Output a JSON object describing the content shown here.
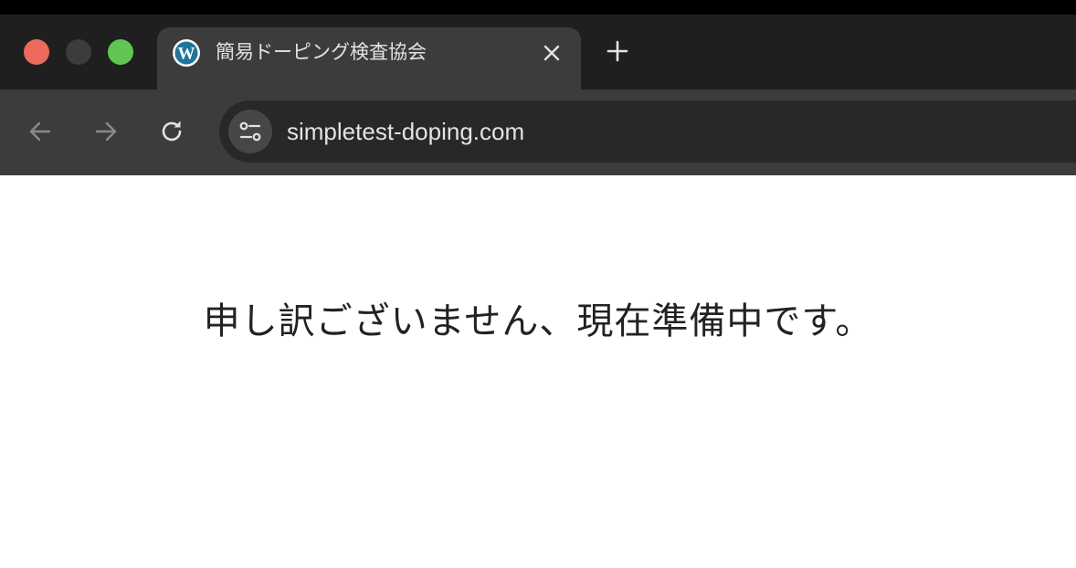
{
  "tab": {
    "title": "簡易ドーピング検査協会",
    "favicon": "wordpress-icon"
  },
  "address_bar": {
    "url": "simpletest-doping.com"
  },
  "page": {
    "message": "申し訳ございません、現在準備中です。"
  },
  "colors": {
    "tabbar_bg": "#1f1f1f",
    "active_tab_bg": "#3c3c3c",
    "toolbar_bg": "#3c3c3c",
    "omnibox_bg": "#282828",
    "close_light": "#ed6a5e",
    "minimize_light": "#3c3c3c",
    "maximize_light": "#61c554",
    "page_bg": "#ffffff",
    "message_text": "#222222"
  }
}
